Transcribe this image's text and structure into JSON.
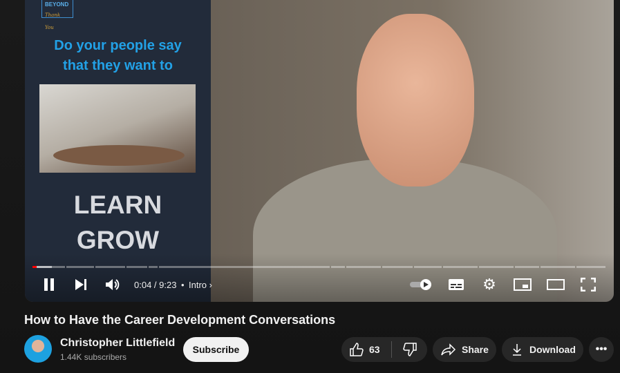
{
  "video": {
    "slide": {
      "logo_word": "BEYOND",
      "logo_script": "Thank You",
      "question": "Do your people say that they want to",
      "words": [
        "LEARN",
        "GROW"
      ]
    },
    "controls": {
      "current_time": "0:04",
      "duration": "9:23",
      "time_display": "0:04 / 9:23",
      "chapter": "Intro",
      "progress_percent": 0.7,
      "buffered_percent": 3.4,
      "autoplay_on": true
    }
  },
  "title": "How to Have the Career Development Conversations",
  "channel": {
    "name": "Christopher Littlefield",
    "subscribers": "1.44K subscribers",
    "subscribe_label": "Subscribe"
  },
  "actions": {
    "likes": "63",
    "share_label": "Share",
    "download_label": "Download"
  },
  "colors": {
    "progress": "#ff0000",
    "background": "#0f0f0f",
    "slide_text": "#22a1e6"
  }
}
